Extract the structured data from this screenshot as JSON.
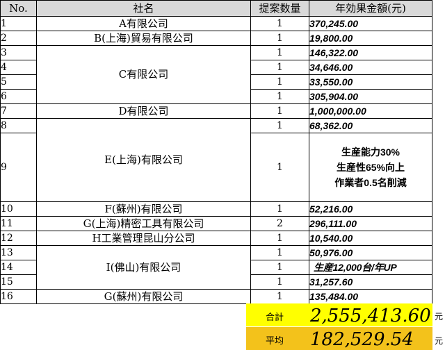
{
  "headers": {
    "no": "No.",
    "company": "社名",
    "count": "提案数量",
    "amount": "年効果金額(元)"
  },
  "rows": [
    {
      "no": "1",
      "company": "A有限公司",
      "count": "1",
      "amount": "370,245.00"
    },
    {
      "no": "2",
      "company": "B(上海)貿易有限公司",
      "count": "1",
      "amount": "19,800.00"
    },
    {
      "no": "3",
      "company": "C有限公司",
      "count": "1",
      "amount": "146,322.00"
    },
    {
      "no": "4",
      "company": "",
      "count": "1",
      "amount": "34,646.00"
    },
    {
      "no": "5",
      "company": "",
      "count": "1",
      "amount": "33,550.00"
    },
    {
      "no": "6",
      "company": "",
      "count": "1",
      "amount": "305,904.00"
    },
    {
      "no": "7",
      "company": "D有限公司",
      "count": "1",
      "amount": "1,000,000.00"
    },
    {
      "no": "8",
      "company": "E(上海)有限公司",
      "count": "1",
      "amount": "68,362.00"
    },
    {
      "no": "9",
      "company": "",
      "count": "1",
      "amount_lines": [
        "生産能力30%",
        "生産性65%向上",
        "作業者0.5名削減"
      ]
    },
    {
      "no": "10",
      "company": "F(蘇州)有限公司",
      "count": "1",
      "amount": "52,216.00"
    },
    {
      "no": "11",
      "company": "G(上海)精密工具有限公司",
      "count": "2",
      "amount": "296,111.00"
    },
    {
      "no": "12",
      "company": "H工業管理昆山分公司",
      "count": "1",
      "amount": "10,540.00"
    },
    {
      "no": "13",
      "company": "I(佛山)有限公司",
      "count": "1",
      "amount": "50,976.00"
    },
    {
      "no": "14",
      "company": "",
      "count": "1",
      "amount": "生産12,000台/年UP"
    },
    {
      "no": "15",
      "company": "",
      "count": "1",
      "amount": "31,257.60"
    },
    {
      "no": "16",
      "company": "G(蘇州)有限公司",
      "count": "1",
      "amount": "135,484.00"
    }
  ],
  "summary": {
    "total_label": "合計",
    "total_value": "2,555,413.60",
    "total_unit": "元",
    "average_label": "平均",
    "average_value": "182,529.54",
    "average_unit": "元"
  },
  "colors": {
    "header_bg": "#d9d9d9",
    "total_bg": "#ffff00",
    "average_bg": "#f3c21b"
  }
}
